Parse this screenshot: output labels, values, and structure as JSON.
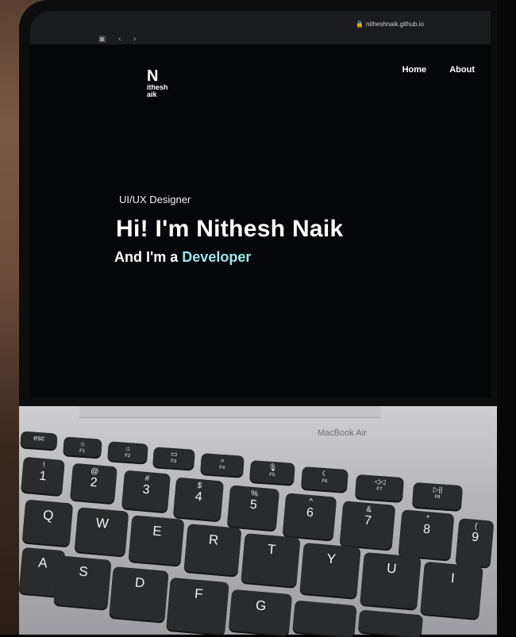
{
  "browser": {
    "url": "nitheshnaik.github.io"
  },
  "site": {
    "logo_big": "N",
    "logo_line1": "ithesh",
    "logo_line2": "aik",
    "nav": [
      "Home",
      "About"
    ],
    "subtitle": "UI/UX Designer",
    "title": "Hi! I'm Nithesh Naik",
    "line_prefix": "And I'm a ",
    "line_accent": "Developer"
  },
  "laptop": {
    "brand": "MacBook Air"
  },
  "keyboard": {
    "fn_row": [
      {
        "top": "esc",
        "bot": ""
      },
      {
        "top": "☼",
        "bot": "F1"
      },
      {
        "top": "☼",
        "bot": "F2"
      },
      {
        "top": "▭",
        "bot": "F3"
      },
      {
        "top": "⌕",
        "bot": "F4"
      },
      {
        "top": "🎙",
        "bot": "F5"
      },
      {
        "top": "☾",
        "bot": "F6"
      },
      {
        "top": "◁◁",
        "bot": "F7"
      },
      {
        "top": "▷||",
        "bot": "F8"
      }
    ],
    "num_row": [
      {
        "top": "!",
        "bot": "1"
      },
      {
        "top": "@",
        "bot": "2"
      },
      {
        "top": "#",
        "bot": "3"
      },
      {
        "top": "$",
        "bot": "4"
      },
      {
        "top": "%",
        "bot": "5"
      },
      {
        "top": "^",
        "bot": "6"
      },
      {
        "top": "&",
        "bot": "7"
      },
      {
        "top": "*",
        "bot": "8"
      },
      {
        "top": "(",
        "bot": "9"
      }
    ],
    "qwerty_row": [
      "Q",
      "W",
      "E",
      "R",
      "T",
      "Y",
      "U",
      "I"
    ],
    "asdf_row": [
      "A",
      "S",
      "D",
      "F",
      "G"
    ]
  },
  "colors": {
    "accent": "#9fe7ea",
    "screen": "#05060a"
  }
}
